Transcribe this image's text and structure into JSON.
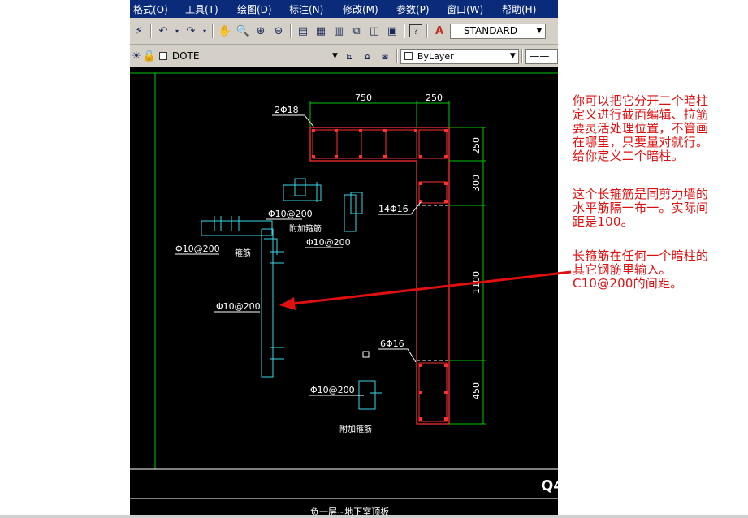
{
  "menu": {
    "items": [
      "格式(O)",
      "工具(T)",
      "绘图(D)",
      "标注(N)",
      "修改(M)",
      "参数(P)",
      "窗口(W)",
      "帮助(H)"
    ]
  },
  "toolbar": {
    "text_style": "STANDARD",
    "layer": "DOTE",
    "color": "ByLayer"
  },
  "drawing": {
    "dims": {
      "top_750": "750",
      "top_250": "250",
      "right_250": "250",
      "right_300": "300",
      "right_1100": "1100",
      "right_450": "450"
    },
    "labels": {
      "bar_2phi18": "2Φ18",
      "bar_14phi16": "14Φ16",
      "bar_6phi16": "6Φ16",
      "stirrup_a": "Φ10@200",
      "stirrup_b": "Φ10@200",
      "stirrup_c": "Φ10@200",
      "stirrup_d": "Φ10@200",
      "stirrup_e": "Φ10@200",
      "extra_tie_1": "附加箍筋",
      "tie_label": "箍筋",
      "extra_tie_2": "附加箍筋",
      "title_code": "Q4",
      "footer": "负一层~地下室顶板"
    }
  },
  "notes": {
    "note1": "你可以把它分开二个暗柱\n定义进行截面编辑、拉筋\n要灵活处理位置，不管画\n在哪里，只要量对就行。\n给你定义二个暗柱。",
    "note2": "这个长箍筋是同剪力墙的\n水平筋隔一布一。实际间\n距是100。",
    "note3": "长箍筋在任何一个暗柱的\n其它钢筋里输入。\nC10@200的间距。"
  },
  "colors": {
    "cad_bg": "#000000",
    "rebar": "#ff3030",
    "outline_green": "#00c800",
    "tie_cyan": "#3ad6e6",
    "annotation_red": "#e01010"
  }
}
